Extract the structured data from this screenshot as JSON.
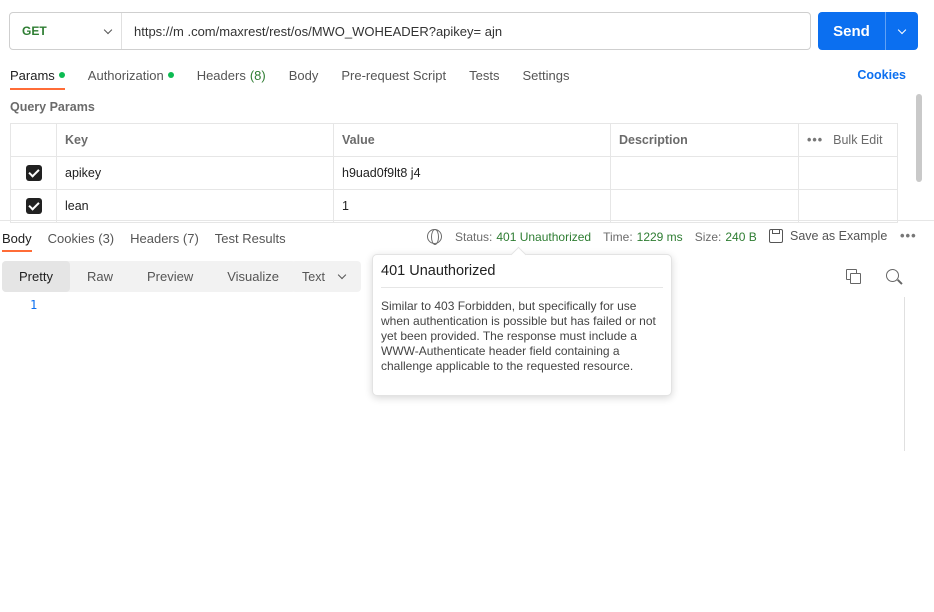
{
  "request": {
    "method": "GET",
    "url": "https://m          .com/maxrest/rest/os/MWO_WOHEADER?apikey=           ajn",
    "send_label": "Send"
  },
  "req_tabs": {
    "params": "Params",
    "authorization": "Authorization",
    "headers": "Headers",
    "headers_count": "(8)",
    "body": "Body",
    "prerequest": "Pre-request Script",
    "tests": "Tests",
    "settings": "Settings",
    "cookies": "Cookies"
  },
  "query_params": {
    "title": "Query Params",
    "columns": {
      "key": "Key",
      "value": "Value",
      "description": "Description",
      "bulk_edit": "Bulk Edit",
      "more": "•••"
    },
    "rows": [
      {
        "key": "apikey",
        "value": "h9uad0f9lt8            j4",
        "description": ""
      },
      {
        "key": "lean",
        "value": "1",
        "description": ""
      }
    ]
  },
  "response": {
    "tabs": {
      "body": "Body",
      "cookies": "Cookies",
      "cookies_count": "(3)",
      "headers": "Headers",
      "headers_count": "(7)",
      "test_results": "Test Results"
    },
    "status_label": "Status:",
    "status_value": "401 Unauthorized",
    "time_label": "Time:",
    "time_value": "1229 ms",
    "size_label": "Size:",
    "size_value": "240 B",
    "save_example": "Save as Example",
    "more": "•••",
    "formats": {
      "pretty": "Pretty",
      "raw": "Raw",
      "preview": "Preview",
      "visualize": "Visualize"
    },
    "text_type": "Text",
    "line_number": "1"
  },
  "tooltip": {
    "title": "401 Unauthorized",
    "body": "Similar to 403 Forbidden, but specifically for use when authentication is possible but has failed or not yet been provided. The response must include a WWW-Authenticate header field containing a challenge applicable to the requested resource."
  },
  "colors": {
    "accent": "#0b6ff0",
    "active_tab": "#ff6c37",
    "status_ok": "#2e7d32",
    "dot": "#0cbb52"
  }
}
